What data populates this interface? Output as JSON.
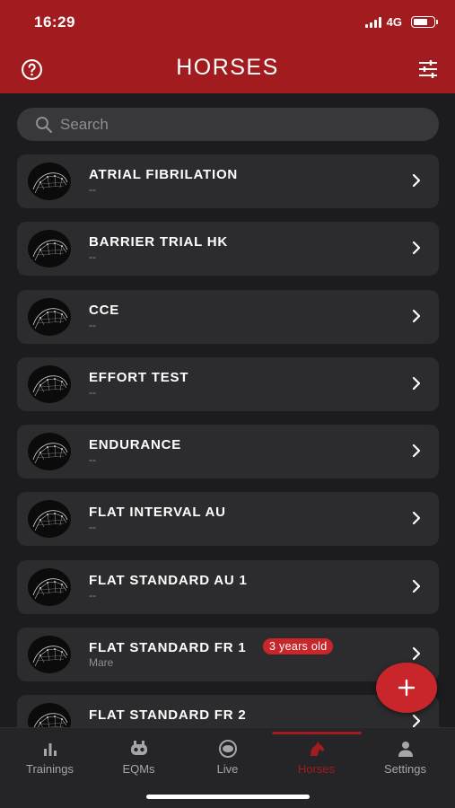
{
  "status_bar": {
    "time": "16:29",
    "network": "4G"
  },
  "header": {
    "title": "HORSES"
  },
  "search": {
    "placeholder": "Search"
  },
  "horses": [
    {
      "name": "ATRIAL FIBRILATION",
      "subtitle": "--",
      "age_badge": ""
    },
    {
      "name": "BARRIER TRIAL HK",
      "subtitle": "--",
      "age_badge": ""
    },
    {
      "name": "CCE",
      "subtitle": "--",
      "age_badge": ""
    },
    {
      "name": "EFFORT TEST",
      "subtitle": "--",
      "age_badge": ""
    },
    {
      "name": "ENDURANCE",
      "subtitle": "--",
      "age_badge": ""
    },
    {
      "name": "FLAT INTERVAL AU",
      "subtitle": "--",
      "age_badge": ""
    },
    {
      "name": "FLAT STANDARD AU 1",
      "subtitle": "--",
      "age_badge": ""
    },
    {
      "name": "FLAT STANDARD FR 1",
      "subtitle": "Mare",
      "age_badge": "3 years old"
    },
    {
      "name": "FLAT STANDARD FR 2",
      "subtitle": "",
      "age_badge": ""
    }
  ],
  "tabs": [
    {
      "label": "Trainings",
      "icon": "bar-chart-icon",
      "active": false
    },
    {
      "label": "EQMs",
      "icon": "device-icon",
      "active": false
    },
    {
      "label": "Live",
      "icon": "eye-icon",
      "active": false
    },
    {
      "label": "Horses",
      "icon": "horse-icon",
      "active": true
    },
    {
      "label": "Settings",
      "icon": "person-icon",
      "active": false
    }
  ],
  "colors": {
    "accent": "#a21c1f",
    "badge": "#c8262a",
    "background": "#1c1c1e",
    "card": "#2c2c2e"
  }
}
